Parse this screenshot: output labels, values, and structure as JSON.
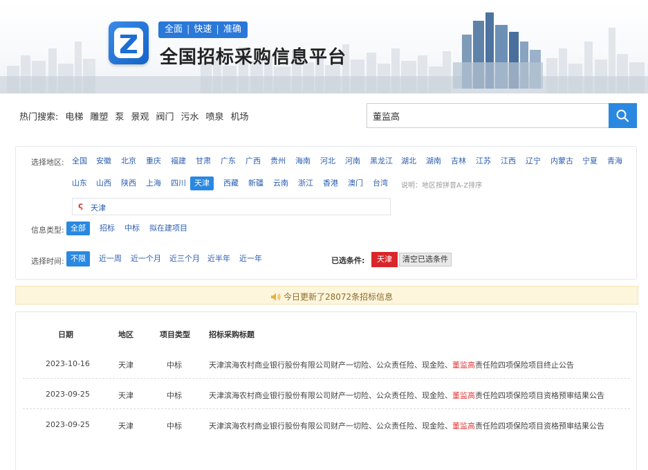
{
  "header": {
    "slogan": [
      "全面",
      "快速",
      "准确"
    ],
    "slogan_sep": "|",
    "title": "全国招标采购信息平台",
    "logo_letter": "Z"
  },
  "search": {
    "hot_label": "热门搜索:",
    "hot_terms": [
      "电梯",
      "雕塑",
      "泵",
      "景观",
      "阀门",
      "污水",
      "喷泉",
      "机场"
    ],
    "query": "董监高",
    "button_icon": "search-icon"
  },
  "filter": {
    "region_label": "选择地区:",
    "regions_row1": [
      "全国",
      "安徽",
      "北京",
      "重庆",
      "福建",
      "甘肃",
      "广东",
      "广西",
      "贵州",
      "海南",
      "河北",
      "河南",
      "黑龙江",
      "湖北",
      "湖南",
      "吉林",
      "江苏",
      "江西",
      "辽宁",
      "内蒙古",
      "宁夏",
      "青海"
    ],
    "regions_row2": [
      "山东",
      "山西",
      "陕西",
      "上海",
      "四川",
      "天津",
      "西藏",
      "新疆",
      "云南",
      "浙江",
      "香港",
      "澳门",
      "台湾"
    ],
    "active_region": "天津",
    "region_note": "说明：地区按拼音A-Z排序",
    "selected_region": "天津",
    "type_label": "信息类型:",
    "types": [
      "全部",
      "招标",
      "中标",
      "拟在建项目"
    ],
    "active_type": "全部",
    "time_label": "选择时间:",
    "times": [
      "不限",
      "近一周",
      "近一个月",
      "近三个月",
      "近半年",
      "近一年"
    ],
    "active_time": "不限",
    "chosen_label": "已选条件:",
    "chosen_tag": "天津",
    "clear_label": "清空已选条件"
  },
  "notice": {
    "icon": "speaker-icon",
    "text": "今日更新了28072条招标信息"
  },
  "results": {
    "columns": [
      "日期",
      "地区",
      "项目类型",
      "招标采购标题"
    ],
    "rows": [
      {
        "date": "2023-10-16",
        "region": "天津",
        "type": "中标",
        "title_pre": "天津滨海农村商业银行股份有限公司财产一切险、公众责任险、现金险、",
        "title_hl": "董监高",
        "title_post": "责任险四项保险项目终止公告"
      },
      {
        "date": "2023-09-25",
        "region": "天津",
        "type": "中标",
        "title_pre": "天津滨海农村商业银行股份有限公司财产一切险、公众责任险、现金险、",
        "title_hl": "董监高",
        "title_post": "责任险四项保险项目资格预审结果公告"
      },
      {
        "date": "2023-09-25",
        "region": "天津",
        "type": "中标",
        "title_pre": "天津滨海农村商业银行股份有限公司财产一切险、公众责任险、现金险、",
        "title_hl": "董监高",
        "title_post": "责任险四项保险项目资格预审结果公告"
      }
    ]
  },
  "colors": {
    "primary_blue": "#2a88e0",
    "link_blue": "#2a5db0",
    "highlight_red": "#e23b3b",
    "tag_red": "#d9262a",
    "notice_bg": "#fdf5dc"
  }
}
